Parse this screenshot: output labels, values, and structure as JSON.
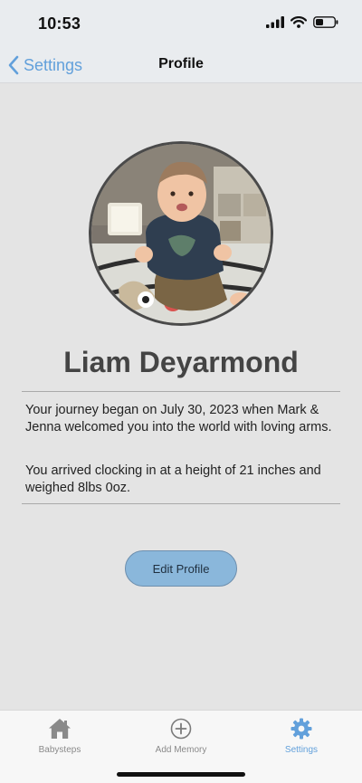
{
  "status_bar": {
    "time": "10:53"
  },
  "nav": {
    "back_label": "Settings",
    "title": "Profile"
  },
  "profile": {
    "name": "Liam Deyarmond",
    "bio_paragraph_1": "Your journey began on July 30, 2023 when Mark & Jenna welcomed you into the world with loving arms.",
    "bio_paragraph_2": "You arrived clocking in at a height of 21 inches and weighed 8lbs 0oz."
  },
  "edit_button_label": "Edit Profile",
  "tabs": [
    {
      "label": "Babysteps",
      "icon": "home-icon",
      "active": false
    },
    {
      "label": "Add Memory",
      "icon": "plus-circle-icon",
      "active": false
    },
    {
      "label": "Settings",
      "icon": "gear-icon",
      "active": true
    }
  ],
  "colors": {
    "accent": "#62a0db",
    "button": "#8ab7db",
    "background": "#e4e4e4"
  }
}
